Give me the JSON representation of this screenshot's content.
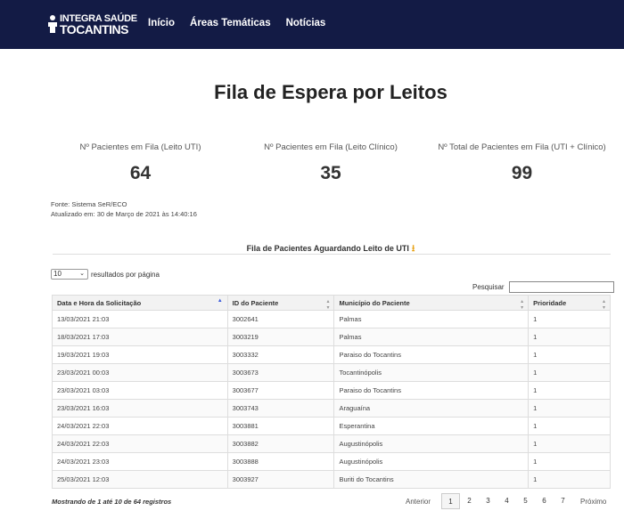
{
  "header": {
    "logo_line1": "INTEGRA SAÚDE",
    "logo_line2": "TOCANTINS",
    "nav": [
      "Início",
      "Áreas Temáticas",
      "Notícias"
    ]
  },
  "page_title": "Fila de Espera por Leitos",
  "stats": [
    {
      "label": "Nº Pacientes em Fila (Leito UTI)",
      "value": "64"
    },
    {
      "label": "Nº Pacientes em Fila (Leito Clínico)",
      "value": "35"
    },
    {
      "label": "Nº Total de Pacientes em Fila (UTI + Clínico)",
      "value": "99"
    }
  ],
  "source": "Fonte: Sistema SeR/ECO",
  "updated": "Atualizado em: 30 de Março de 2021 às 14:40:16",
  "section_title": "Fila de Pacientes Aguardando Leito de UTI",
  "length_menu": {
    "value": "10",
    "suffix": "resultados por página"
  },
  "search": {
    "label": "Pesquisar",
    "value": ""
  },
  "table": {
    "headers": [
      "Data e Hora da Solicitação",
      "ID do Paciente",
      "Município do Paciente",
      "Prioridade"
    ],
    "rows": [
      [
        "13/03/2021 21:03",
        "3002641",
        "Palmas",
        "1"
      ],
      [
        "18/03/2021 17:03",
        "3003219",
        "Palmas",
        "1"
      ],
      [
        "19/03/2021 19:03",
        "3003332",
        "Paraiso do Tocantins",
        "1"
      ],
      [
        "23/03/2021 00:03",
        "3003673",
        "Tocantinópolis",
        "1"
      ],
      [
        "23/03/2021 03:03",
        "3003677",
        "Paraiso do Tocantins",
        "1"
      ],
      [
        "23/03/2021 16:03",
        "3003743",
        "Araguaína",
        "1"
      ],
      [
        "24/03/2021 22:03",
        "3003881",
        "Esperantina",
        "1"
      ],
      [
        "24/03/2021 22:03",
        "3003882",
        "Augustinópolis",
        "1"
      ],
      [
        "24/03/2021 23:03",
        "3003888",
        "Augustinópolis",
        "1"
      ],
      [
        "25/03/2021 12:03",
        "3003927",
        "Buriti do Tocantins",
        "1"
      ]
    ]
  },
  "info": "Mostrando de 1 até 10 de 64 registros",
  "pagination": {
    "previous": "Anterior",
    "pages": [
      "1",
      "2",
      "3",
      "4",
      "5",
      "6",
      "7"
    ],
    "current": "1",
    "next": "Próximo"
  },
  "icons": {
    "download": "download-icon",
    "sort_asc": "sort-asc-icon",
    "sort_both": "sort-both-icon"
  },
  "colors": {
    "navbar": "#131b45",
    "accent_download": "#e8a317"
  }
}
